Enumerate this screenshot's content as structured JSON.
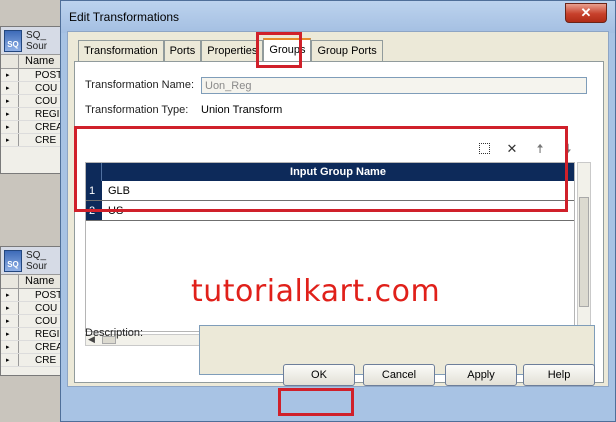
{
  "background": {
    "panels": [
      {
        "header_lines": [
          "SQ_",
          "Sour"
        ],
        "icon_text": "SQ",
        "column": "Name",
        "rows": [
          "POST",
          "COU",
          "COU",
          "REGI",
          "CREA",
          "CRE"
        ]
      },
      {
        "header_lines": [
          "SQ_",
          "Sour"
        ],
        "icon_text": "SQ",
        "column": "Name",
        "rows": [
          "POST",
          "COU",
          "COU",
          "REGI",
          "CREA",
          "CRE"
        ]
      }
    ]
  },
  "dialog": {
    "title": "Edit Transformations",
    "close_label": "✕",
    "tabs": [
      "Transformation",
      "Ports",
      "Properties",
      "Groups",
      "Group Ports"
    ],
    "active_tab": "Groups",
    "name_label": "Transformation Name:",
    "name_value": "Uon_Reg",
    "type_label": "Transformation Type:",
    "type_value": "Union Transform",
    "toolbar_icons": [
      "new-icon",
      "delete-icon",
      "up-arrow-icon",
      "down-arrow-icon"
    ],
    "grid_header": "Input Group Name",
    "groups": [
      {
        "num": "1",
        "name": "GLB"
      },
      {
        "num": "2",
        "name": "US"
      }
    ],
    "watermark": "tutorialkart.com",
    "description_label": "Description:",
    "description_value": "",
    "buttons": {
      "ok": "OK",
      "cancel": "Cancel",
      "apply": "Apply",
      "help": "Help"
    }
  },
  "colors": {
    "highlight": "#d0202a",
    "grid_header": "#0d2a5a",
    "watermark": "#e0201a"
  }
}
